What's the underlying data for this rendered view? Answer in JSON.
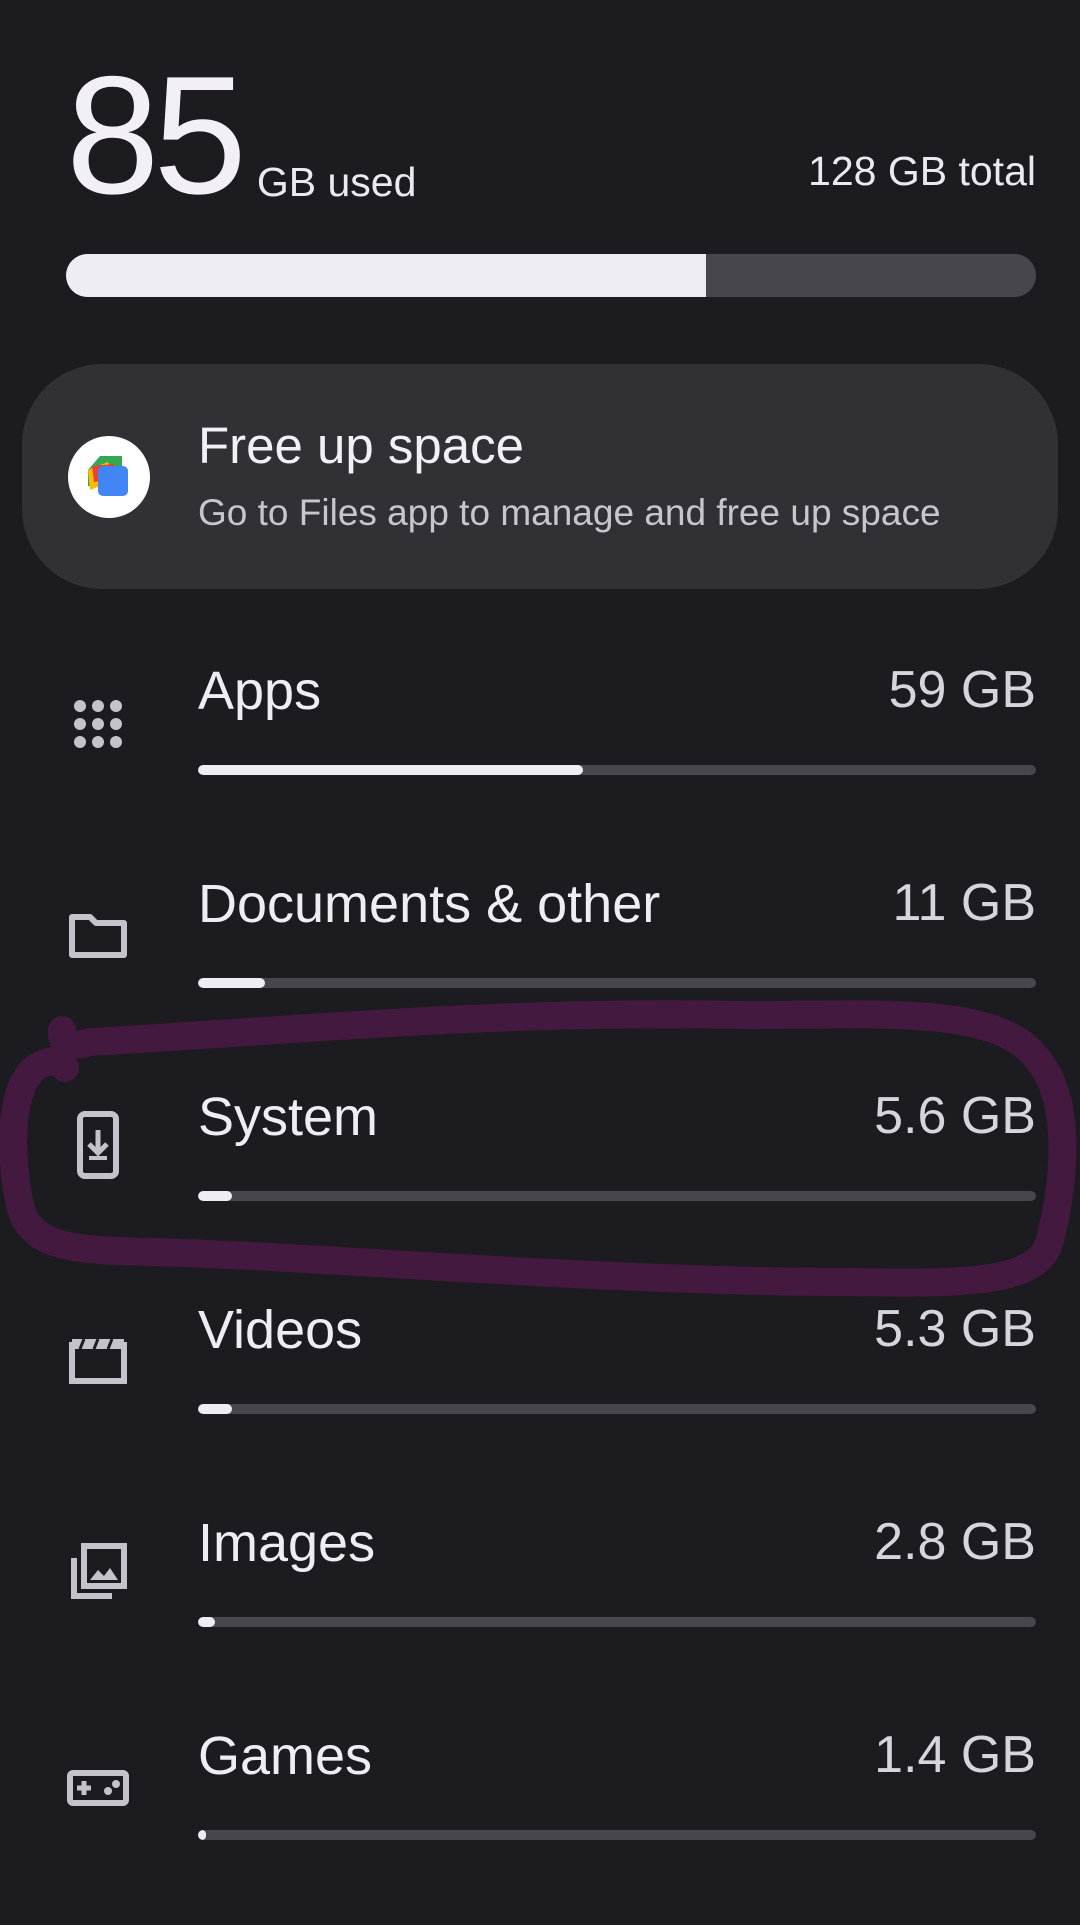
{
  "storage_summary": {
    "used_value": "85",
    "used_unit": "GB used",
    "total_label": "128 GB total",
    "used_fraction": 0.66
  },
  "free_up_card": {
    "title": "Free up space",
    "subtitle": "Go to Files app to manage and free up space",
    "icon": "files-app-icon"
  },
  "categories": [
    {
      "name": "Apps",
      "size": "59 GB",
      "icon": "apps-grid-icon",
      "fraction": 0.46
    },
    {
      "name": "Documents & other",
      "size": "11 GB",
      "icon": "folder-icon",
      "fraction": 0.08
    },
    {
      "name": "System",
      "size": "5.6 GB",
      "icon": "system-update-icon",
      "fraction": 0.04
    },
    {
      "name": "Videos",
      "size": "5.3 GB",
      "icon": "movie-icon",
      "fraction": 0.04
    },
    {
      "name": "Images",
      "size": "2.8 GB",
      "icon": "photo-library-icon",
      "fraction": 0.02
    },
    {
      "name": "Games",
      "size": "1.4 GB",
      "icon": "gamepad-icon",
      "fraction": 0.01
    }
  ],
  "colors": {
    "background": "#1c1b20",
    "card": "#303035",
    "bar_track": "#47464c",
    "bar_fill": "#efedf4",
    "annotation_stroke": "#43193f"
  }
}
